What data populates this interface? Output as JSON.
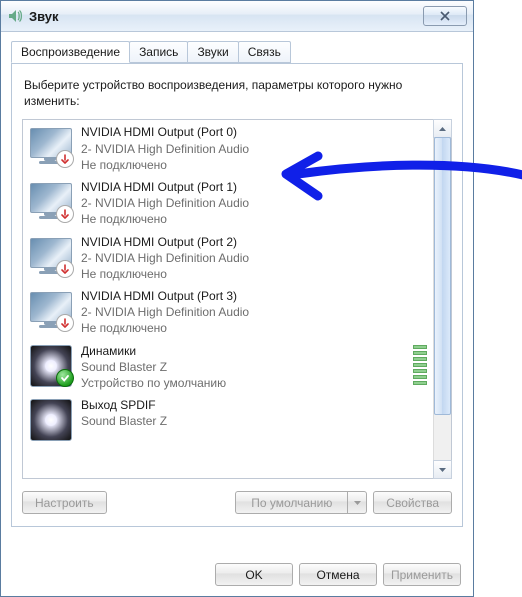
{
  "window": {
    "title": "Звук"
  },
  "tabs": [
    {
      "label": "Воспроизведение",
      "active": true
    },
    {
      "label": "Запись",
      "active": false
    },
    {
      "label": "Звуки",
      "active": false
    },
    {
      "label": "Связь",
      "active": false
    }
  ],
  "instruction": "Выберите устройство воспроизведения, параметры которого нужно изменить:",
  "devices": [
    {
      "name": "NVIDIA HDMI Output (Port 0)",
      "desc": "2- NVIDIA High Definition Audio",
      "status": "Не подключено",
      "icon": "monitor",
      "badge": "unplugged"
    },
    {
      "name": "NVIDIA HDMI Output (Port 1)",
      "desc": "2- NVIDIA High Definition Audio",
      "status": "Не подключено",
      "icon": "monitor",
      "badge": "unplugged"
    },
    {
      "name": "NVIDIA HDMI Output (Port 2)",
      "desc": "2- NVIDIA High Definition Audio",
      "status": "Не подключено",
      "icon": "monitor",
      "badge": "unplugged"
    },
    {
      "name": "NVIDIA HDMI Output (Port 3)",
      "desc": "2- NVIDIA High Definition Audio",
      "status": "Не подключено",
      "icon": "monitor",
      "badge": "unplugged"
    },
    {
      "name": "Динамики",
      "desc": "Sound Blaster Z",
      "status": "Устройство по умолчанию",
      "icon": "speaker",
      "badge": "default",
      "level": true
    },
    {
      "name": "Выход SPDIF",
      "desc": "Sound Blaster Z",
      "status": "",
      "icon": "speaker",
      "badge": "",
      "partial": true
    }
  ],
  "panel_buttons": {
    "configure": "Настроить",
    "set_default": "По умолчанию",
    "properties": "Свойства"
  },
  "dialog_buttons": {
    "ok": "OK",
    "cancel": "Отмена",
    "apply": "Применить"
  }
}
